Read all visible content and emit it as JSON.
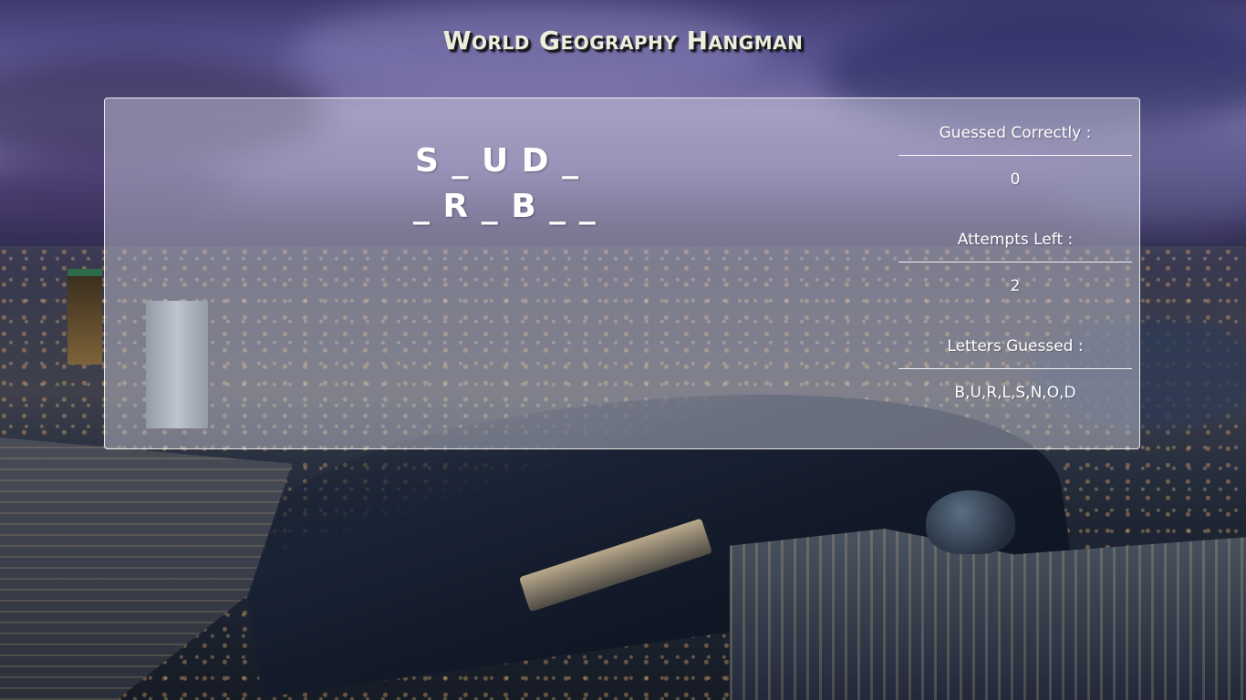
{
  "page": {
    "title": "World Geography Hangman"
  },
  "game": {
    "word_lines": [
      "S _ U D _",
      "_ R _ B _ _"
    ],
    "stats": {
      "correct_label": "Guessed Correctly :",
      "correct_value": "0",
      "attempts_label": "Attempts Left :",
      "attempts_value": "2",
      "letters_label": "Letters Guessed :",
      "letters_value": "B,U,R,L,S,N,O,D"
    }
  },
  "colors": {
    "title_text": "#eeeede",
    "panel_bg": "rgba(220,220,230,0.42)",
    "text": "#ffffff"
  },
  "background": {
    "scene": "night-city-skyline-photo"
  }
}
